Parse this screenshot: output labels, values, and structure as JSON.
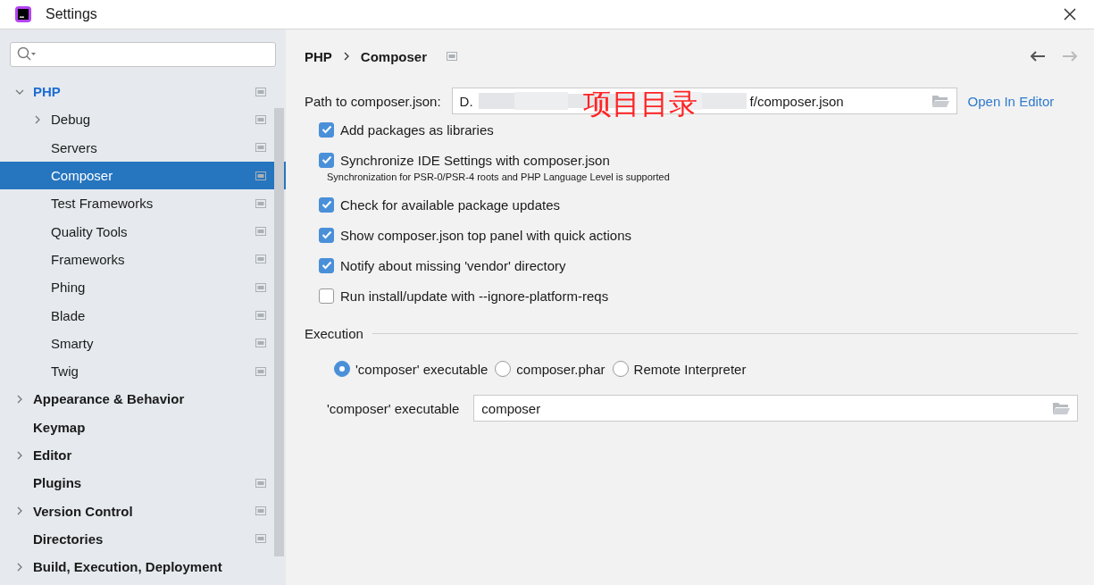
{
  "window": {
    "title": "Settings"
  },
  "sidebar": {
    "items": [
      {
        "label": "PHP",
        "selected": false,
        "expanded": true,
        "scoped": true,
        "children": [
          {
            "label": "Debug",
            "selected": false,
            "expanded": false,
            "scoped": true
          },
          {
            "label": "Servers",
            "selected": false,
            "scoped": true
          },
          {
            "label": "Composer",
            "selected": true,
            "scoped": true
          },
          {
            "label": "Test Frameworks",
            "selected": false,
            "scoped": true
          },
          {
            "label": "Quality Tools",
            "selected": false,
            "scoped": true
          },
          {
            "label": "Frameworks",
            "selected": false,
            "scoped": true
          },
          {
            "label": "Phing",
            "selected": false,
            "scoped": true
          },
          {
            "label": "Blade",
            "selected": false,
            "scoped": true
          },
          {
            "label": "Smarty",
            "selected": false,
            "scoped": true
          },
          {
            "label": "Twig",
            "selected": false,
            "scoped": true
          }
        ]
      },
      {
        "label": "Appearance & Behavior",
        "selected": false,
        "expanded": false,
        "scoped": false
      },
      {
        "label": "Keymap",
        "selected": false,
        "scoped": false
      },
      {
        "label": "Editor",
        "selected": false,
        "expanded": false,
        "scoped": false
      },
      {
        "label": "Plugins",
        "selected": false,
        "scoped": true
      },
      {
        "label": "Version Control",
        "selected": false,
        "expanded": false,
        "scoped": true
      },
      {
        "label": "Directories",
        "selected": false,
        "scoped": true
      },
      {
        "label": "Build, Execution, Deployment",
        "selected": false,
        "expanded": false,
        "scoped": false
      }
    ]
  },
  "header": {
    "breadcrumb": [
      "PHP",
      "Composer"
    ],
    "back": {
      "disabled": false
    },
    "forward": {
      "disabled": true
    }
  },
  "path": {
    "label": "Path to composer.json:",
    "value_start": "D.",
    "value_end": "f/composer.json",
    "annotation": "项目目录",
    "link": "Open In Editor"
  },
  "options": [
    {
      "label": "Add packages as libraries",
      "checked": true
    },
    {
      "label": "Synchronize IDE Settings with composer.json",
      "checked": true,
      "note": "Synchronization for PSR-0/PSR-4 roots and PHP Language Level is supported"
    },
    {
      "label": "Check for available package updates",
      "checked": true
    },
    {
      "label": "Show composer.json top panel with quick actions",
      "checked": true
    },
    {
      "label": "Notify about missing 'vendor' directory",
      "checked": true
    },
    {
      "label": "Run install/update with --ignore-platform-reqs",
      "checked": false
    }
  ],
  "execution": {
    "title": "Execution",
    "radios": [
      {
        "label": "'composer' executable",
        "selected": true
      },
      {
        "label": "composer.phar",
        "selected": false
      },
      {
        "label": "Remote Interpreter",
        "selected": false
      }
    ],
    "field": {
      "label": "'composer' executable",
      "value": "composer"
    }
  }
}
